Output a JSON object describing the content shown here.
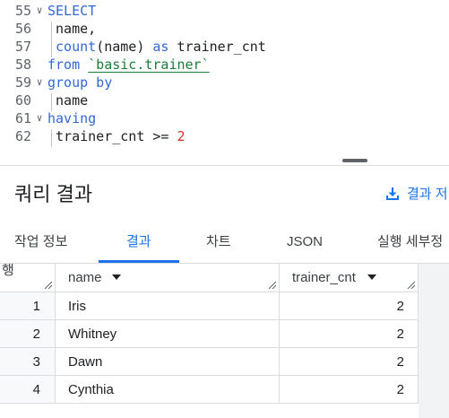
{
  "editor": {
    "lines": [
      {
        "number": "55",
        "fold": "∨",
        "tokens": [
          {
            "cls": "kw",
            "text": "SELECT"
          }
        ]
      },
      {
        "number": "56",
        "fold": "",
        "tokens": [
          {
            "cls": "plain",
            "text": " name,"
          }
        ]
      },
      {
        "number": "57",
        "fold": "",
        "tokens": [
          {
            "cls": "kw",
            "text": " count"
          },
          {
            "cls": "plain",
            "text": "(name) "
          },
          {
            "cls": "kw",
            "text": "as"
          },
          {
            "cls": "plain",
            "text": " trainer_cnt"
          }
        ]
      },
      {
        "number": "58",
        "fold": "",
        "tokens": [
          {
            "cls": "kw",
            "text": "from "
          },
          {
            "cls": "str",
            "text": "`basic.trainer`"
          }
        ]
      },
      {
        "number": "59",
        "fold": "∨",
        "tokens": [
          {
            "cls": "kw",
            "text": "group by"
          }
        ]
      },
      {
        "number": "60",
        "fold": "",
        "tokens": [
          {
            "cls": "plain",
            "text": " name"
          }
        ]
      },
      {
        "number": "61",
        "fold": "∨",
        "tokens": [
          {
            "cls": "kw",
            "text": "having"
          }
        ]
      },
      {
        "number": "62",
        "fold": "",
        "tokens": [
          {
            "cls": "plain",
            "text": " trainer_cnt >= "
          },
          {
            "cls": "num",
            "text": "2"
          }
        ]
      }
    ]
  },
  "results": {
    "title": "쿼리 결과",
    "save_label": "결과 저",
    "save_icon": "download-icon"
  },
  "tabs": [
    {
      "label": "작업 정보",
      "active": false
    },
    {
      "label": "결과",
      "active": true
    },
    {
      "label": "차트",
      "active": false
    },
    {
      "label": "JSON",
      "active": false
    },
    {
      "label": "실행 세부정",
      "active": false
    }
  ],
  "table": {
    "row_header": "행",
    "columns": [
      "name",
      "trainer_cnt"
    ],
    "rows": [
      {
        "num": "1",
        "name": "Iris",
        "trainer_cnt": "2"
      },
      {
        "num": "2",
        "name": "Whitney",
        "trainer_cnt": "2"
      },
      {
        "num": "3",
        "name": "Dawn",
        "trainer_cnt": "2"
      },
      {
        "num": "4",
        "name": "Cynthia",
        "trainer_cnt": "2"
      }
    ]
  },
  "colors": {
    "accent": "#1a73e8",
    "keyword": "#3367d6",
    "string": "#188038",
    "number": "#d93025"
  }
}
